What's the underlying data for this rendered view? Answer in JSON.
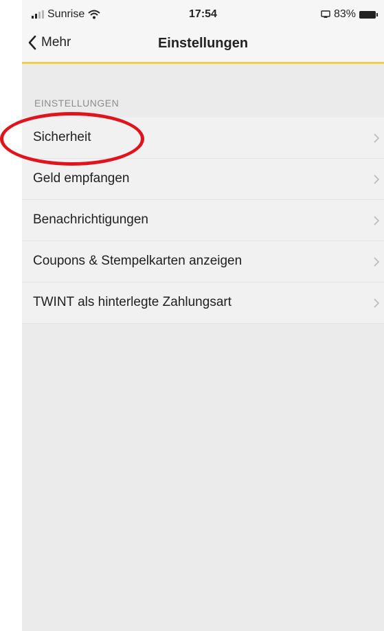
{
  "status_bar": {
    "carrier": "Sunrise",
    "time": "17:54",
    "battery": "83%"
  },
  "nav": {
    "back_label": "Mehr",
    "title": "Einstellungen",
    "accent_color": "#f1cd4a"
  },
  "section": {
    "header": "EINSTELLUNGEN",
    "items": [
      {
        "label": "Sicherheit"
      },
      {
        "label": "Geld empfangen"
      },
      {
        "label": "Benachrichtigungen"
      },
      {
        "label": "Coupons & Stempelkarten anzeigen"
      },
      {
        "label": "TWINT als hinterlegte Zahlungsart"
      }
    ]
  },
  "annotation": {
    "highlight_color": "#e0141c",
    "highlighted_item": "Sicherheit"
  }
}
